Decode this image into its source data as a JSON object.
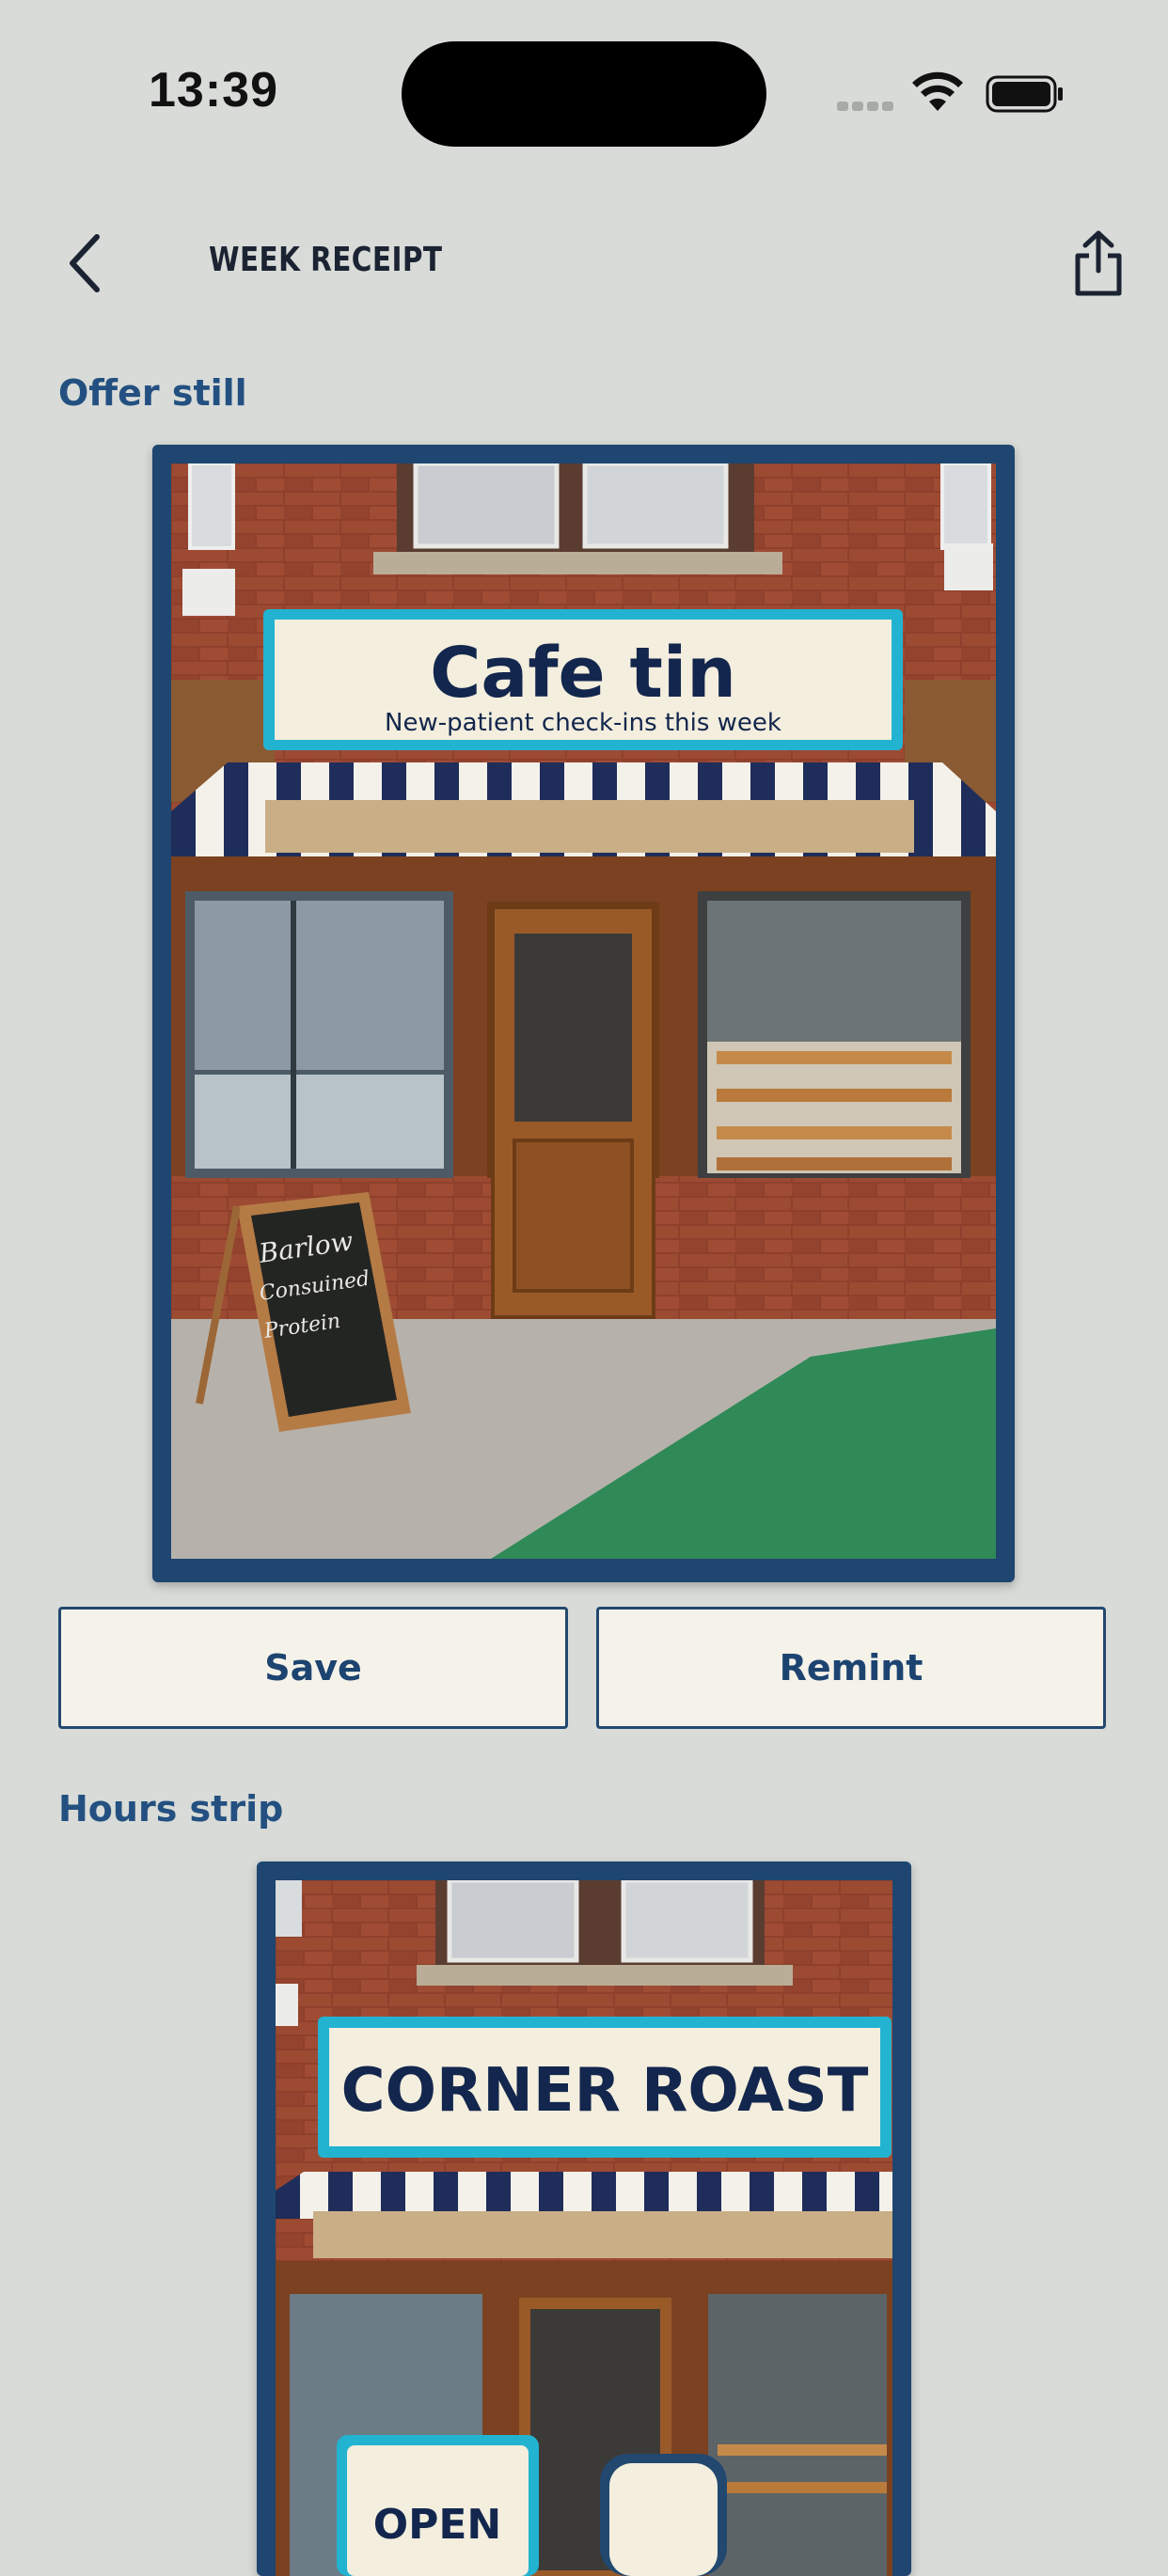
{
  "status_bar": {
    "time": "13:39"
  },
  "nav": {
    "title": "WEEK RECEIPT",
    "back_icon": "chevron-left-icon",
    "share_icon": "share-icon"
  },
  "offer_section": {
    "heading": "Offer still",
    "sign_title": "Cafe tin",
    "sign_subtitle": "New-patient check-ins this week",
    "chalkboard_lines": [
      "Barlow",
      "Consuined",
      "Protein"
    ]
  },
  "actions": {
    "save_label": "Save",
    "remint_label": "Remint"
  },
  "hours_section": {
    "heading": "Hours strip",
    "sign_title": "CORNER ROAST",
    "open_sign": "OPEN"
  },
  "colors": {
    "background": "#d8dbd7",
    "frame": "#1e4670",
    "accent_text": "#235081",
    "button_fill": "#f5f2e9"
  }
}
